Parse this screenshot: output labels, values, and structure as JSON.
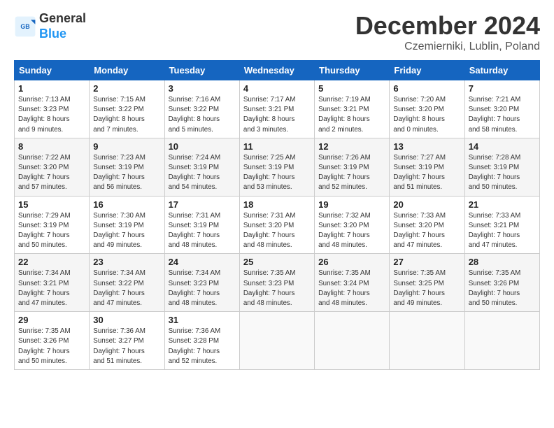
{
  "logo": {
    "line1": "General",
    "line2": "Blue"
  },
  "header": {
    "month": "December 2024",
    "location": "Czemierniki, Lublin, Poland"
  },
  "weekdays": [
    "Sunday",
    "Monday",
    "Tuesday",
    "Wednesday",
    "Thursday",
    "Friday",
    "Saturday"
  ],
  "weeks": [
    [
      {
        "day": "1",
        "info": "Sunrise: 7:13 AM\nSunset: 3:23 PM\nDaylight: 8 hours\nand 9 minutes."
      },
      {
        "day": "2",
        "info": "Sunrise: 7:15 AM\nSunset: 3:22 PM\nDaylight: 8 hours\nand 7 minutes."
      },
      {
        "day": "3",
        "info": "Sunrise: 7:16 AM\nSunset: 3:22 PM\nDaylight: 8 hours\nand 5 minutes."
      },
      {
        "day": "4",
        "info": "Sunrise: 7:17 AM\nSunset: 3:21 PM\nDaylight: 8 hours\nand 3 minutes."
      },
      {
        "day": "5",
        "info": "Sunrise: 7:19 AM\nSunset: 3:21 PM\nDaylight: 8 hours\nand 2 minutes."
      },
      {
        "day": "6",
        "info": "Sunrise: 7:20 AM\nSunset: 3:20 PM\nDaylight: 8 hours\nand 0 minutes."
      },
      {
        "day": "7",
        "info": "Sunrise: 7:21 AM\nSunset: 3:20 PM\nDaylight: 7 hours\nand 58 minutes."
      }
    ],
    [
      {
        "day": "8",
        "info": "Sunrise: 7:22 AM\nSunset: 3:20 PM\nDaylight: 7 hours\nand 57 minutes."
      },
      {
        "day": "9",
        "info": "Sunrise: 7:23 AM\nSunset: 3:19 PM\nDaylight: 7 hours\nand 56 minutes."
      },
      {
        "day": "10",
        "info": "Sunrise: 7:24 AM\nSunset: 3:19 PM\nDaylight: 7 hours\nand 54 minutes."
      },
      {
        "day": "11",
        "info": "Sunrise: 7:25 AM\nSunset: 3:19 PM\nDaylight: 7 hours\nand 53 minutes."
      },
      {
        "day": "12",
        "info": "Sunrise: 7:26 AM\nSunset: 3:19 PM\nDaylight: 7 hours\nand 52 minutes."
      },
      {
        "day": "13",
        "info": "Sunrise: 7:27 AM\nSunset: 3:19 PM\nDaylight: 7 hours\nand 51 minutes."
      },
      {
        "day": "14",
        "info": "Sunrise: 7:28 AM\nSunset: 3:19 PM\nDaylight: 7 hours\nand 50 minutes."
      }
    ],
    [
      {
        "day": "15",
        "info": "Sunrise: 7:29 AM\nSunset: 3:19 PM\nDaylight: 7 hours\nand 50 minutes."
      },
      {
        "day": "16",
        "info": "Sunrise: 7:30 AM\nSunset: 3:19 PM\nDaylight: 7 hours\nand 49 minutes."
      },
      {
        "day": "17",
        "info": "Sunrise: 7:31 AM\nSunset: 3:19 PM\nDaylight: 7 hours\nand 48 minutes."
      },
      {
        "day": "18",
        "info": "Sunrise: 7:31 AM\nSunset: 3:20 PM\nDaylight: 7 hours\nand 48 minutes."
      },
      {
        "day": "19",
        "info": "Sunrise: 7:32 AM\nSunset: 3:20 PM\nDaylight: 7 hours\nand 48 minutes."
      },
      {
        "day": "20",
        "info": "Sunrise: 7:33 AM\nSunset: 3:20 PM\nDaylight: 7 hours\nand 47 minutes."
      },
      {
        "day": "21",
        "info": "Sunrise: 7:33 AM\nSunset: 3:21 PM\nDaylight: 7 hours\nand 47 minutes."
      }
    ],
    [
      {
        "day": "22",
        "info": "Sunrise: 7:34 AM\nSunset: 3:21 PM\nDaylight: 7 hours\nand 47 minutes."
      },
      {
        "day": "23",
        "info": "Sunrise: 7:34 AM\nSunset: 3:22 PM\nDaylight: 7 hours\nand 47 minutes."
      },
      {
        "day": "24",
        "info": "Sunrise: 7:34 AM\nSunset: 3:23 PM\nDaylight: 7 hours\nand 48 minutes."
      },
      {
        "day": "25",
        "info": "Sunrise: 7:35 AM\nSunset: 3:23 PM\nDaylight: 7 hours\nand 48 minutes."
      },
      {
        "day": "26",
        "info": "Sunrise: 7:35 AM\nSunset: 3:24 PM\nDaylight: 7 hours\nand 48 minutes."
      },
      {
        "day": "27",
        "info": "Sunrise: 7:35 AM\nSunset: 3:25 PM\nDaylight: 7 hours\nand 49 minutes."
      },
      {
        "day": "28",
        "info": "Sunrise: 7:35 AM\nSunset: 3:26 PM\nDaylight: 7 hours\nand 50 minutes."
      }
    ],
    [
      {
        "day": "29",
        "info": "Sunrise: 7:35 AM\nSunset: 3:26 PM\nDaylight: 7 hours\nand 50 minutes."
      },
      {
        "day": "30",
        "info": "Sunrise: 7:36 AM\nSunset: 3:27 PM\nDaylight: 7 hours\nand 51 minutes."
      },
      {
        "day": "31",
        "info": "Sunrise: 7:36 AM\nSunset: 3:28 PM\nDaylight: 7 hours\nand 52 minutes."
      },
      {
        "day": "",
        "info": ""
      },
      {
        "day": "",
        "info": ""
      },
      {
        "day": "",
        "info": ""
      },
      {
        "day": "",
        "info": ""
      }
    ]
  ]
}
